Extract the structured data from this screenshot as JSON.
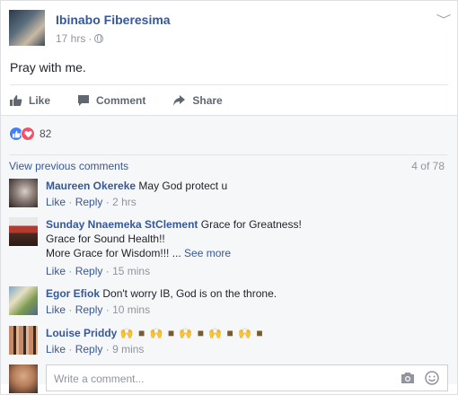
{
  "post": {
    "author": "Ibinabo Fiberesima",
    "time": "17 hrs",
    "dot": "·",
    "text": "Pray with me.",
    "chevron": "﹀"
  },
  "actions": {
    "like": "Like",
    "comment": "Comment",
    "share": "Share"
  },
  "reactions": {
    "count": "82",
    "icons": [
      "like-reaction-icon",
      "love-reaction-icon"
    ]
  },
  "comments_meta": {
    "view_previous": "View previous comments",
    "count": "4 of 78"
  },
  "comments": [
    {
      "name": "Maureen Okereke",
      "text": "May God protect u",
      "like": "Like",
      "reply": "Reply",
      "time": "2 hrs"
    },
    {
      "name": "Sunday Nnaemeka StClement",
      "text_line1": "Grace for Greatness!",
      "text_line2": "Grace for Sound Health!!",
      "text_line3": "More Grace for Wisdom!!! ...",
      "see_more": "See more",
      "like": "Like",
      "reply": "Reply",
      "time": "15 mins"
    },
    {
      "name": "Egor Efiok",
      "text": "Don't worry IB, God is on the throne.",
      "like": "Like",
      "reply": "Reply",
      "time": "10 mins"
    },
    {
      "name": "Louise Priddy",
      "text": "🙌 ■ 🙌 ■ 🙌 ■ 🙌 ■ 🙌 ■",
      "like": "Like",
      "reply": "Reply",
      "time": "9 mins"
    }
  ],
  "composer": {
    "placeholder": "Write a comment..."
  },
  "separator": "·"
}
